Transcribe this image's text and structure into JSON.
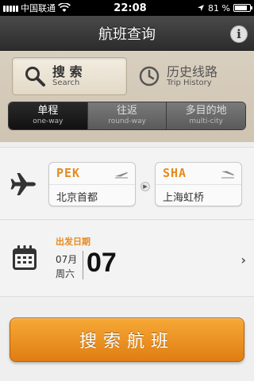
{
  "status_bar": {
    "carrier": "中国联通",
    "time": "22:08",
    "battery": "81 %",
    "battery_level": 0.81,
    "icons": [
      "signal-icon",
      "wifi-icon",
      "location-arrow-icon",
      "battery-icon"
    ]
  },
  "nav": {
    "title": "航班查询",
    "info_label": "i"
  },
  "mode_tabs": [
    {
      "cn": "搜 索",
      "en": "Search",
      "icon": "search-icon",
      "active": true
    },
    {
      "cn": "历史线路",
      "en": "Trip History",
      "icon": "clock-icon",
      "active": false
    }
  ],
  "trip_types": [
    {
      "cn": "单程",
      "en": "one-way",
      "active": true
    },
    {
      "cn": "往返",
      "en": "round-way",
      "active": false
    },
    {
      "cn": "多目的地",
      "en": "multi-city",
      "active": false
    }
  ],
  "route": {
    "from": {
      "code": "PEK",
      "name": "北京首都",
      "icon": "takeoff-icon"
    },
    "to": {
      "code": "SHA",
      "name": "上海虹桥",
      "icon": "landing-icon"
    },
    "swap_label": "▶"
  },
  "date": {
    "label": "出发日期",
    "month": "07月",
    "weekday": "周六",
    "day": "07",
    "chevron": "›"
  },
  "search_button": {
    "label": "搜索航班"
  },
  "colors": {
    "accent": "#e58a1f",
    "button_top": "#f6a936",
    "button_bottom": "#e07d12",
    "nav_bg": "#3a3a3a"
  }
}
